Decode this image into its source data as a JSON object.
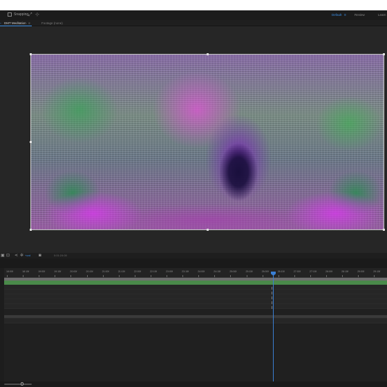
{
  "toolbar": {
    "snapping_label": "Snapping",
    "workspaces": [
      "Default",
      "Review",
      "Learn"
    ],
    "active_workspace": "Default"
  },
  "tabs": {
    "comp_tab": "DMT Meditation",
    "footage_tab": "Footage (none)"
  },
  "timeline": {
    "comp_label": "+ord",
    "time_display": "0:01:24:00",
    "ruler_labels": [
      "18:00f",
      "18:15f",
      "19:00f",
      "19:15f",
      "20:00f",
      "20:15f",
      "21:00f",
      "21:15f",
      "22:00f",
      "22:15f",
      "23:00f",
      "23:15f",
      "24:00f",
      "24:15f",
      "25:00f",
      "25:15f",
      "26:00f",
      "26:15f",
      "27:00f",
      "27:15f",
      "28:00f",
      "28:15f",
      "29:00f",
      "29:15f"
    ],
    "keyframe_glyph": "I"
  },
  "colors": {
    "accent": "#3a8ee6",
    "playhead": "#3a7fd4",
    "clip": "#4a8a4a",
    "panel_bg": "#262626"
  }
}
